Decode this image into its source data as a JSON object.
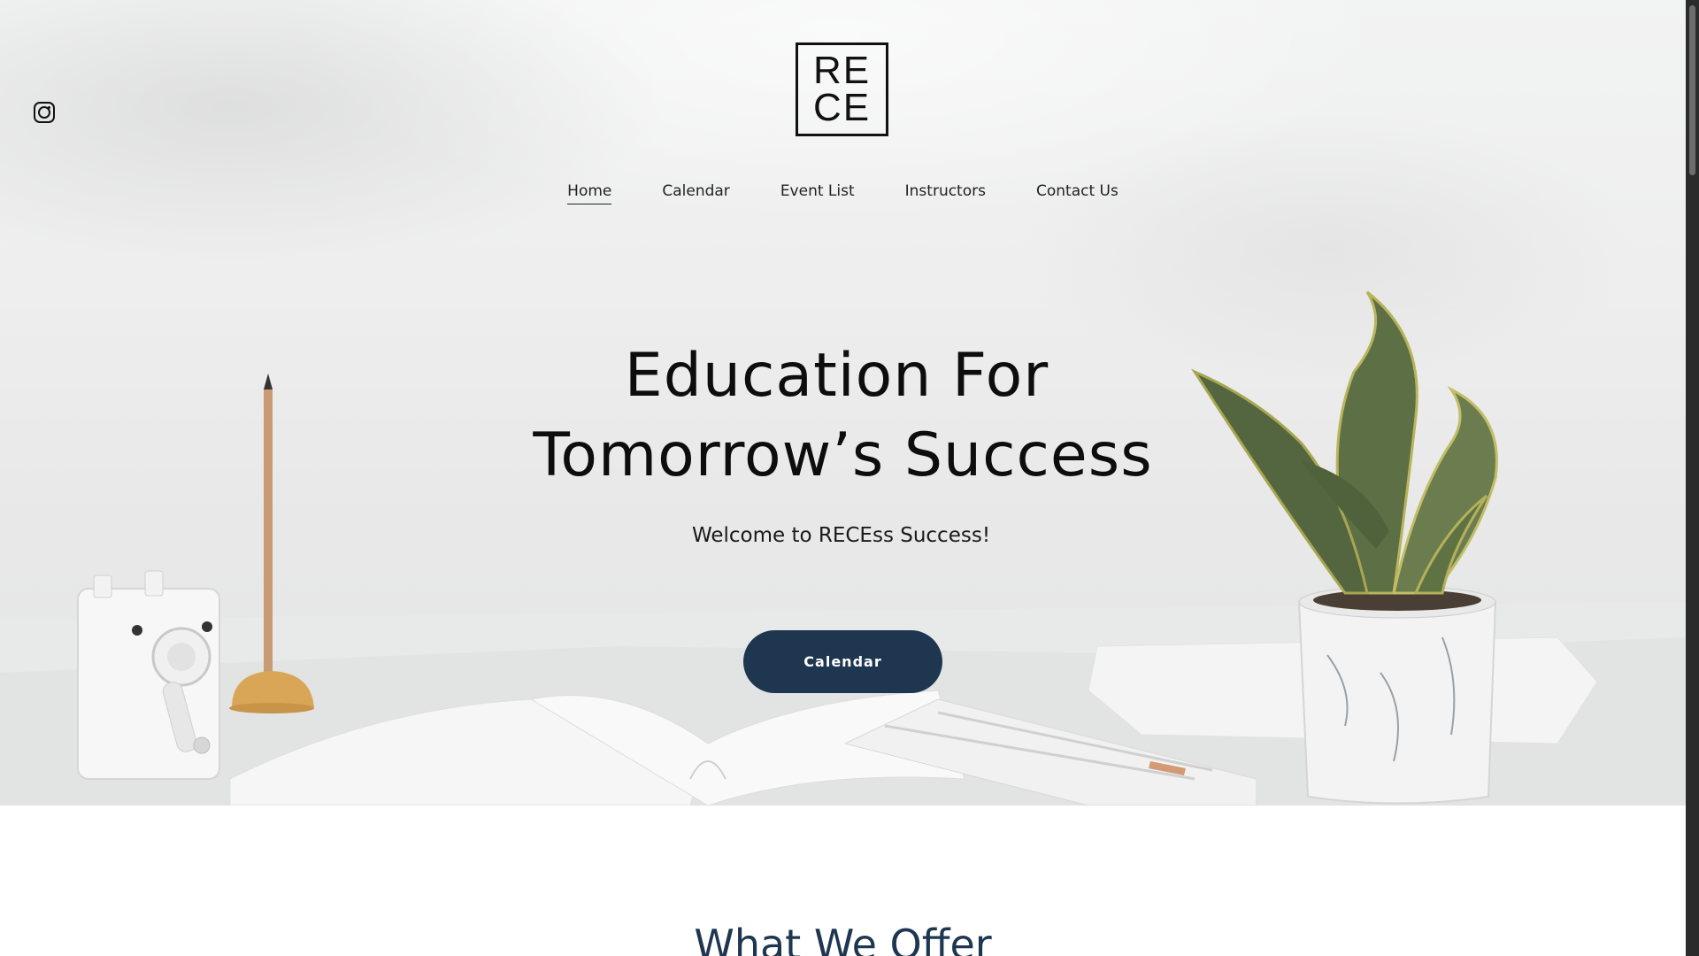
{
  "header": {
    "logo_line1": "RE",
    "logo_line2": "CE",
    "social_icon": "instagram-icon"
  },
  "nav": {
    "items": [
      {
        "label": "Home",
        "active": true
      },
      {
        "label": "Calendar",
        "active": false
      },
      {
        "label": "Event List",
        "active": false
      },
      {
        "label": "Instructors",
        "active": false
      },
      {
        "label": "Contact Us",
        "active": false
      }
    ]
  },
  "hero": {
    "headline_line1": "Education For",
    "headline_line2": "Tomorrow’s Success",
    "subtitle": "Welcome to RECEss Success!",
    "cta_label": "Calendar"
  },
  "offer": {
    "title": "What We Offer"
  },
  "colors": {
    "accent": "#1e3650",
    "text": "#0d0d0d"
  }
}
